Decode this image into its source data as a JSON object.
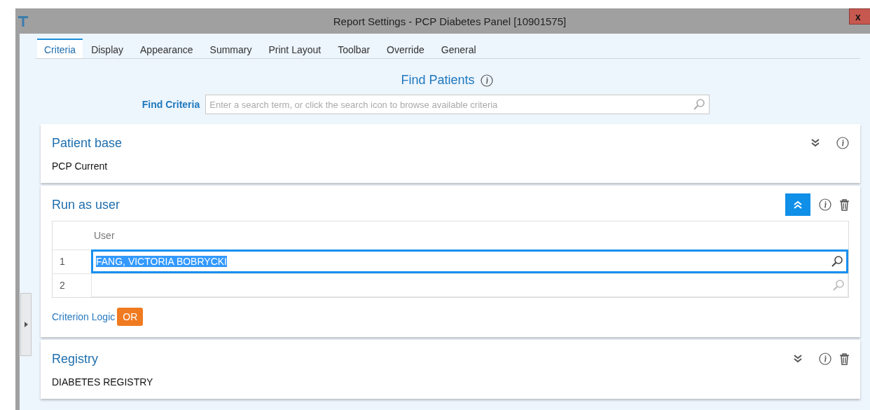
{
  "window": {
    "title": "Report Settings - PCP Diabetes Panel [10901575]",
    "close": "x"
  },
  "tabs": [
    {
      "label": "Criteria",
      "selected": true
    },
    {
      "label": "Display",
      "selected": false
    },
    {
      "label": "Appearance",
      "selected": false
    },
    {
      "label": "Summary",
      "selected": false
    },
    {
      "label": "Print Layout",
      "selected": false
    },
    {
      "label": "Toolbar",
      "selected": false
    },
    {
      "label": "Override",
      "selected": false
    },
    {
      "label": "General",
      "selected": false
    }
  ],
  "heading": "Find Patients",
  "find_criteria": {
    "label": "Find Criteria",
    "placeholder": "Enter a search term, or click the search icon to browse available criteria"
  },
  "sections": [
    {
      "kind": "value",
      "title": "Patient base",
      "expanded": false,
      "deletable": false,
      "value": "PCP Current"
    },
    {
      "kind": "table",
      "title": "Run as user",
      "expanded": true,
      "deletable": true,
      "column": "User",
      "rows": [
        {
          "number": "1",
          "value": "FANG, VICTORIA BOBRYCKI",
          "focused": true
        },
        {
          "number": "2",
          "value": "",
          "focused": false
        }
      ],
      "logic_label": "Criterion Logic",
      "logic": "OR"
    },
    {
      "kind": "value",
      "title": "Registry",
      "expanded": false,
      "deletable": true,
      "value": "DIABETES REGISTRY"
    }
  ]
}
